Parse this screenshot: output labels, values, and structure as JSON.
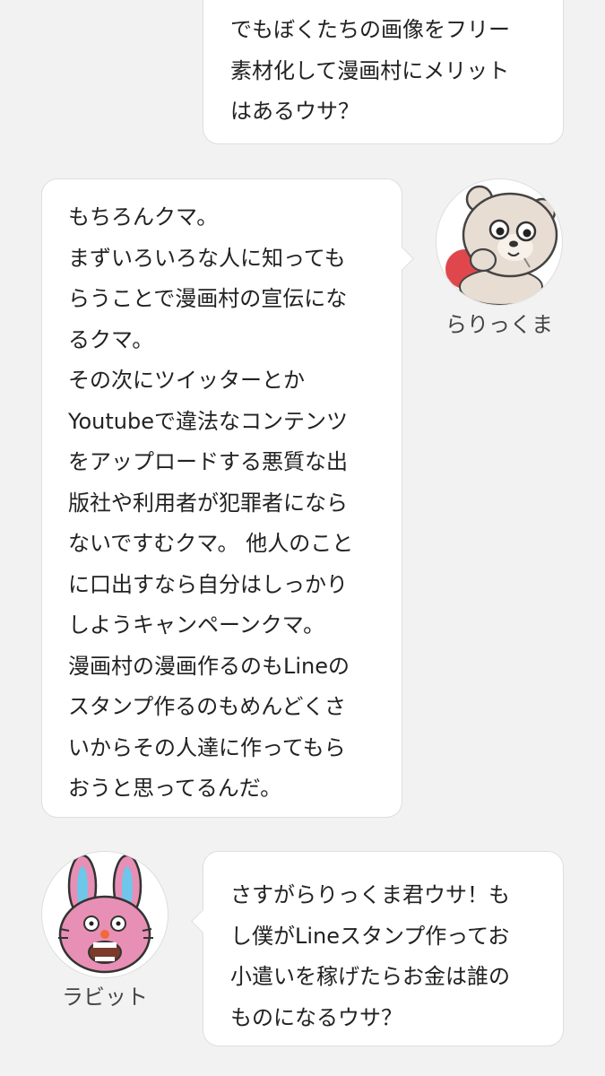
{
  "messages": [
    {
      "speaker": "ラビット",
      "lines": [
        "でもぼくたちの画像をフリー",
        "素材化して漫画村にメリット",
        "はあるウサ？"
      ]
    },
    {
      "speaker": "らりっくま",
      "lines": [
        "もちろんクマ。",
        "まずいろいろな人に知っても",
        "らうことで漫画村の宣伝にな",
        "るクマ。",
        "その次にツイッターとか",
        "Youtubeで違法なコンテンツ",
        "をアップロードする悪質な出",
        "版社や利用者が犯罪者になら",
        "ないですむクマ。 他人のこと",
        "に口出すなら自分はしっかり",
        "しようキャンペーンクマ。",
        "漫画村の漫画作るのもLineの",
        "スタンプ作るのもめんどくさ",
        "いからその人達に作ってもら",
        "おうと思ってるんだ。"
      ]
    },
    {
      "speaker": "ラビット",
      "lines": [
        "さすがらりっくま君ウサ！も",
        "し僕がLineスタンプ作ってお",
        "小遣いを稼げたらお金は誰の",
        "ものになるウサ？"
      ]
    }
  ],
  "names": {
    "bear": "らりっくま",
    "rabbit": "ラビット"
  },
  "icons": {
    "bear_avatar": "bear-avatar-icon",
    "rabbit_avatar": "rabbit-avatar-icon"
  },
  "colors": {
    "background": "#f2f2f2",
    "bubble": "#ffffff",
    "border": "#dedede",
    "text": "#222222"
  }
}
